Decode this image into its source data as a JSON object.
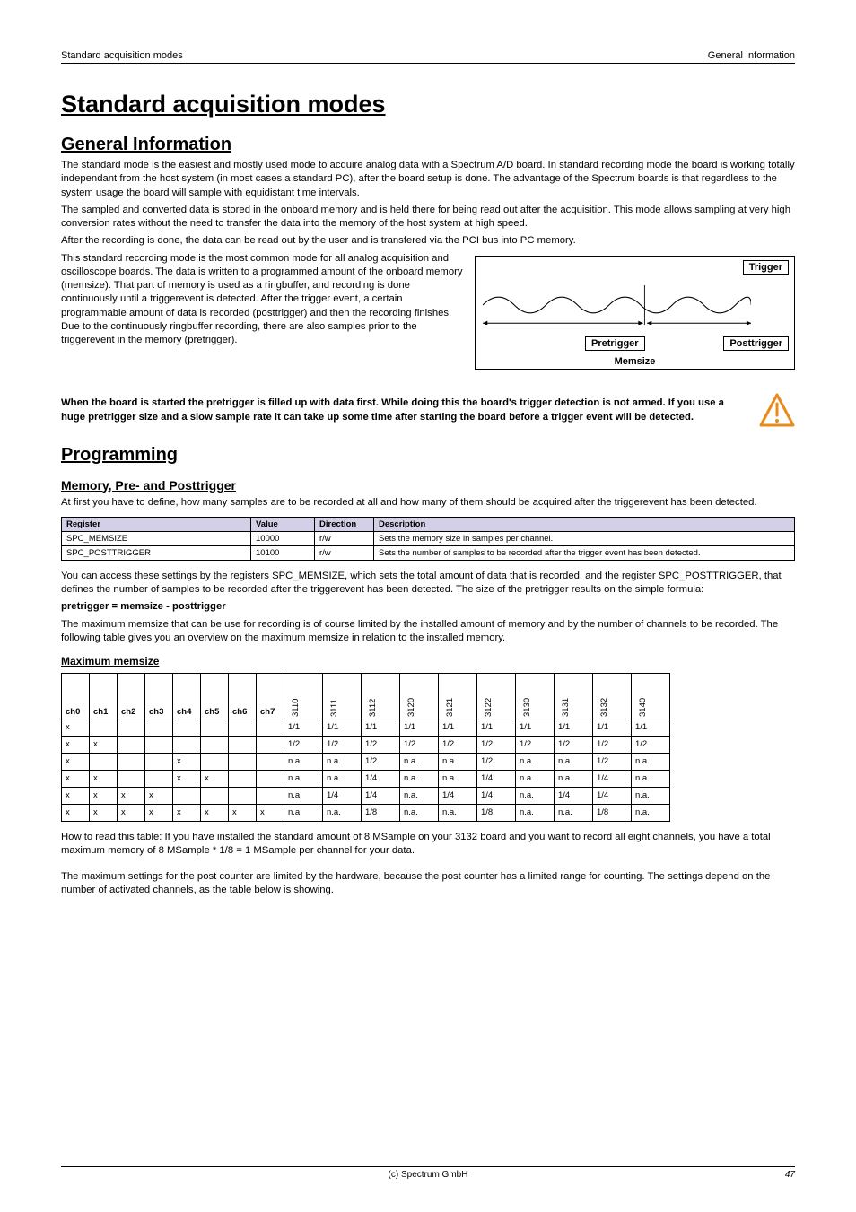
{
  "header": {
    "left": "Standard acquisition modes",
    "right": "General Information"
  },
  "title": "Standard acquisition modes",
  "general_info_h": "General Information",
  "general_info_p1": "The standard mode is the easiest and mostly used mode to acquire analog data with a Spectrum A/D board. In standard recording mode the board is working totally independant from the host system (in most cases a standard PC), after the board setup is done. The advantage of the Spectrum boards is that regardless to the system usage the board will sample with equidistant time intervals.",
  "general_info_p2": "The sampled and converted data is stored in the onboard memory and is held there for being read out after the acquisition. This mode allows sampling at very high conversion rates without the need to transfer the data into the memory of the host system at high speed.",
  "general_info_p3": "After the recording is done, the data can be read out by the user and is transfered via the PCI bus into PC memory.",
  "general_info_p4": "This standard recording mode is the most common mode for all analog acquisition and oscilloscope boards. The data is written to a programmed amount of the onboard memory (memsize). That part of memory is used as a ringbuffer, and recording is done continuously until a triggerevent is detected. After the trigger event, a certain programmable amount of data is recorded (posttrigger) and then the recording finishes. Due to the continuously ringbuffer recording, there are also samples prior to the triggerevent in the memory (pretrigger).",
  "diagram": {
    "trigger": "Trigger",
    "pre": "Pretrigger",
    "post": "Posttrigger",
    "mem": "Memsize"
  },
  "warning": "When the board is started the pretrigger is filled up with data first. While doing this the board's trigger detection is not armed. If you use a huge pretrigger size and a slow sample rate it can take up some time after starting the board before a trigger event will be detected.",
  "programming_h": "Programming",
  "mem_h": "Memory, Pre- and Posttrigger",
  "mem_p1": "At first you have to define, how many samples are to be recorded at all and how many of them should be acquired after the triggerevent has been detected.",
  "reg_table": {
    "headers": [
      "Register",
      "Value",
      "Direction",
      "Description"
    ],
    "rows": [
      [
        "SPC_MEMSIZE",
        "10000",
        "r/w",
        "Sets the memory size in samples per channel."
      ],
      [
        "SPC_POSTTRIGGER",
        "10100",
        "r/w",
        "Sets the number of samples to be recorded after the trigger event has been detected."
      ]
    ]
  },
  "mem_p2": "You can access these settings by the registers SPC_MEMSIZE, which sets the total amount of data that is recorded, and the register SPC_POSTTRIGGER, that defines the number of samples to be recorded after the triggerevent has been detected. The size of the pretrigger results on the simple formula:",
  "formula": "pretrigger = memsize - posttrigger",
  "mem_p3": "The maximum memsize that can be use for recording is of course limited by the installed amount of memory and by the number of channels to be recorded. The following table gives you an overview on the maximum memsize in relation to the installed memory.",
  "max_mem_h": "Maximum memsize",
  "mem_table": {
    "ch_headers": [
      "ch0",
      "ch1",
      "ch2",
      "ch3",
      "ch4",
      "ch5",
      "ch6",
      "ch7"
    ],
    "model_headers": [
      "3110",
      "3111",
      "3112",
      "3120",
      "3121",
      "3122",
      "3130",
      "3131",
      "3132",
      "3140"
    ],
    "rows": [
      {
        "ch": [
          "x",
          "",
          "",
          "",
          "",
          "",
          "",
          ""
        ],
        "m": [
          "1/1",
          "1/1",
          "1/1",
          "1/1",
          "1/1",
          "1/1",
          "1/1",
          "1/1",
          "1/1",
          "1/1"
        ]
      },
      {
        "ch": [
          "x",
          "x",
          "",
          "",
          "",
          "",
          "",
          ""
        ],
        "m": [
          "1/2",
          "1/2",
          "1/2",
          "1/2",
          "1/2",
          "1/2",
          "1/2",
          "1/2",
          "1/2",
          "1/2"
        ]
      },
      {
        "ch": [
          "x",
          "",
          "",
          "",
          "x",
          "",
          "",
          ""
        ],
        "m": [
          "n.a.",
          "n.a.",
          "1/2",
          "n.a.",
          "n.a.",
          "1/2",
          "n.a.",
          "n.a.",
          "1/2",
          "n.a."
        ]
      },
      {
        "ch": [
          "x",
          "x",
          "",
          "",
          "x",
          "x",
          "",
          ""
        ],
        "m": [
          "n.a.",
          "n.a.",
          "1/4",
          "n.a.",
          "n.a.",
          "1/4",
          "n.a.",
          "n.a.",
          "1/4",
          "n.a."
        ]
      },
      {
        "ch": [
          "x",
          "x",
          "x",
          "x",
          "",
          "",
          "",
          ""
        ],
        "m": [
          "n.a.",
          "1/4",
          "1/4",
          "n.a.",
          "1/4",
          "1/4",
          "n.a.",
          "1/4",
          "1/4",
          "n.a."
        ]
      },
      {
        "ch": [
          "x",
          "x",
          "x",
          "x",
          "x",
          "x",
          "x",
          "x"
        ],
        "m": [
          "n.a.",
          "n.a.",
          "1/8",
          "n.a.",
          "n.a.",
          "1/8",
          "n.a.",
          "n.a.",
          "1/8",
          "n.a."
        ]
      }
    ]
  },
  "mem_p4": "How to read this table: If you have installed the standard amount of 8 MSample on your 3132 board and you want to record all eight channels, you have a total maximum memory of 8 MSample * 1/8 = 1 MSample per channel for your data.",
  "mem_p5": "The maximum settings for the post counter are limited by the hardware, because the post counter has a limited range for counting. The settings depend on the number of activated channels, as the table below is showing.",
  "footer": {
    "center": "(c) Spectrum GmbH",
    "page": "47"
  }
}
